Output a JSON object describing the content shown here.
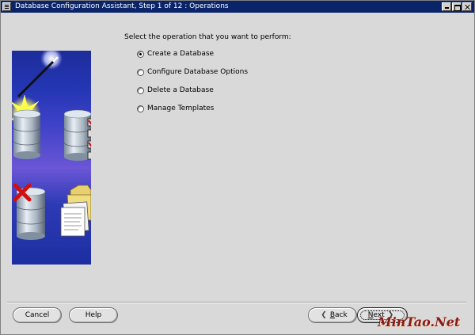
{
  "window": {
    "title": "Database Configuration Assistant, Step 1 of 12 : Operations"
  },
  "main": {
    "prompt": "Select the operation that you want to perform:",
    "options": [
      {
        "label": "Create a Database",
        "selected": true
      },
      {
        "label": "Configure Database Options",
        "selected": false
      },
      {
        "label": "Delete a Database",
        "selected": false
      },
      {
        "label": "Manage Templates",
        "selected": false
      }
    ]
  },
  "buttons": {
    "cancel": "Cancel",
    "help": "Help",
    "back_arrow": "❮",
    "back_hot": "B",
    "back_rest": "ack",
    "next_hot": "N",
    "next_rest": "ext",
    "next_arrow": "❯"
  },
  "icons": {
    "window_menu": "window-menu-icon",
    "minimize": "minimize-icon",
    "maximize": "maximize-icon",
    "close": "close-icon",
    "illustration": "database-wizard-illustration"
  },
  "colors": {
    "titlebar": "#0a246a",
    "background": "#d9d9d9",
    "illustration_blue": "#2436b4",
    "check_red": "#d01010",
    "watermark": "#8b1a1a"
  },
  "watermark": "MinTao.Net"
}
